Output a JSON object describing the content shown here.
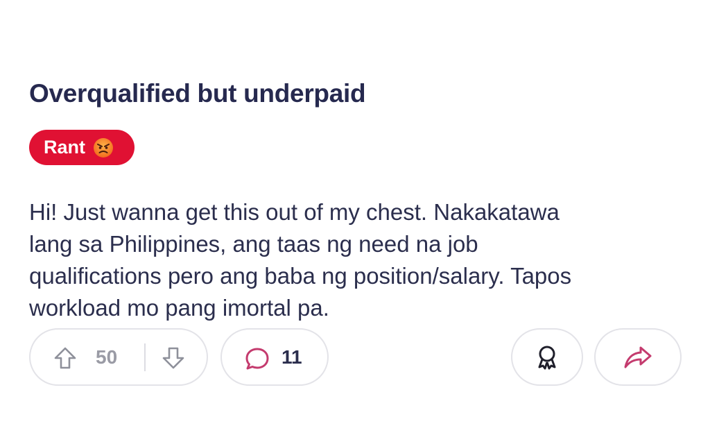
{
  "post": {
    "title": "Overqualified but underpaid",
    "flair": {
      "label": "Rant",
      "emoji": "angry-face-emoji",
      "color": "#e01133"
    },
    "body": "Hi! Just wanna get this out of my chest. Nakakatawa\nlang sa Philippines, ang taas ng need na job\nqualifications pero ang baba ng position/salary. Tapos\nworkload mo pang imortal pa.",
    "actions": {
      "upvote_icon": "arrow-up-icon",
      "vote_count": "50",
      "downvote_icon": "arrow-down-icon",
      "comment_icon": "speech-bubble-icon",
      "comment_count": "11",
      "award_icon": "award-ribbon-icon",
      "share_icon": "share-arrow-icon"
    }
  },
  "colors": {
    "title": "#26294f",
    "body_text": "#2b2e4d",
    "accent_pink": "#c43b6e",
    "muted": "#9a9ba5"
  }
}
